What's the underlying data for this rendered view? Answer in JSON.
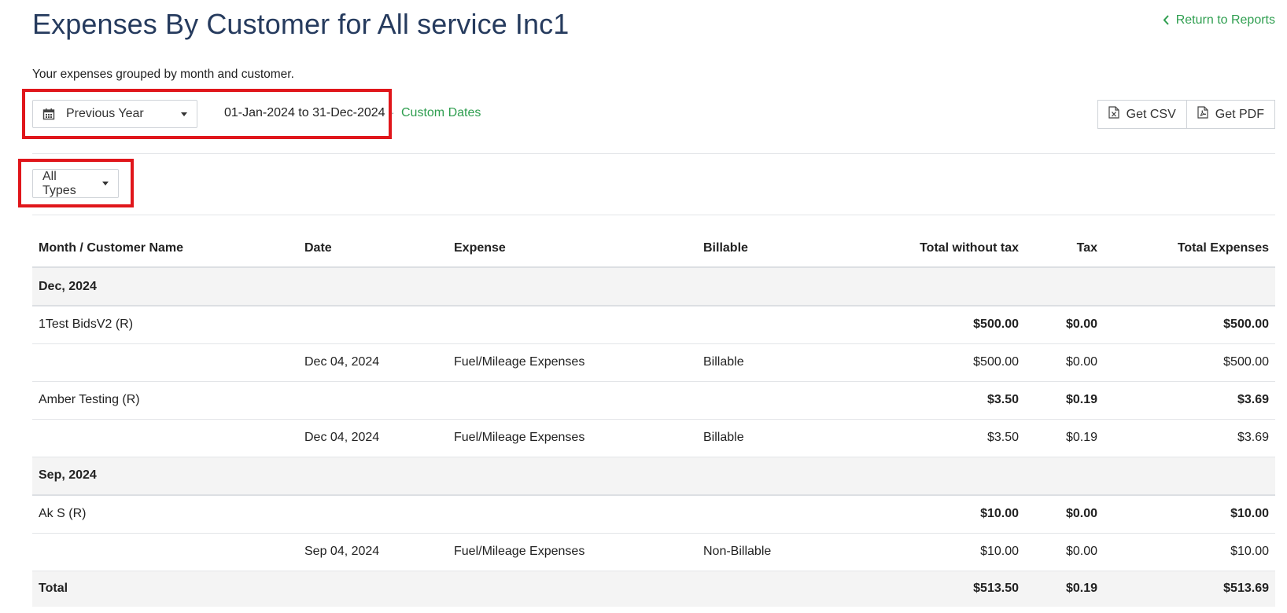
{
  "header": {
    "title": "Expenses By Customer for All service Inc1",
    "return_label": "Return to Reports",
    "subtitle": "Your expenses grouped by month and customer."
  },
  "filters": {
    "range_label": "Previous Year",
    "date_range": "01-Jan-2024 to 31-Dec-2024",
    "separator": "·",
    "custom_dates_label": "Custom Dates",
    "type_label": "All Types"
  },
  "export": {
    "csv_label": "Get CSV",
    "pdf_label": "Get PDF"
  },
  "table": {
    "columns": [
      "Month / Customer Name",
      "Date",
      "Expense",
      "Billable",
      "Total without tax",
      "Tax",
      "Total Expenses"
    ],
    "months": [
      {
        "label": "Dec, 2024",
        "customers": [
          {
            "name": "1Test BidsV2 (R)",
            "total_without_tax": "$500.00",
            "tax": "$0.00",
            "total": "$500.00",
            "expense": {
              "date": "Dec 04, 2024",
              "type": "Fuel/Mileage Expenses",
              "billable": "Billable",
              "total_without_tax": "$500.00",
              "tax": "$0.00",
              "total": "$500.00"
            }
          },
          {
            "name": "Amber Testing (R)",
            "total_without_tax": "$3.50",
            "tax": "$0.19",
            "total": "$3.69",
            "expense": {
              "date": "Dec 04, 2024",
              "type": "Fuel/Mileage Expenses",
              "billable": "Billable",
              "total_without_tax": "$3.50",
              "tax": "$0.19",
              "total": "$3.69"
            }
          }
        ]
      },
      {
        "label": "Sep, 2024",
        "customers": [
          {
            "name": "Ak S (R)",
            "total_without_tax": "$10.00",
            "tax": "$0.00",
            "total": "$10.00",
            "expense": {
              "date": "Sep 04, 2024",
              "type": "Fuel/Mileage Expenses",
              "billable": "Non-Billable",
              "total_without_tax": "$10.00",
              "tax": "$0.00",
              "total": "$10.00"
            }
          }
        ]
      }
    ],
    "total": {
      "label": "Total",
      "total_without_tax": "$513.50",
      "tax": "$0.19",
      "total": "$513.69"
    }
  },
  "colors": {
    "title": "#263b5e",
    "link": "#2e9e4f",
    "highlight": "#e0161b",
    "group_row_bg": "#f4f4f4"
  }
}
